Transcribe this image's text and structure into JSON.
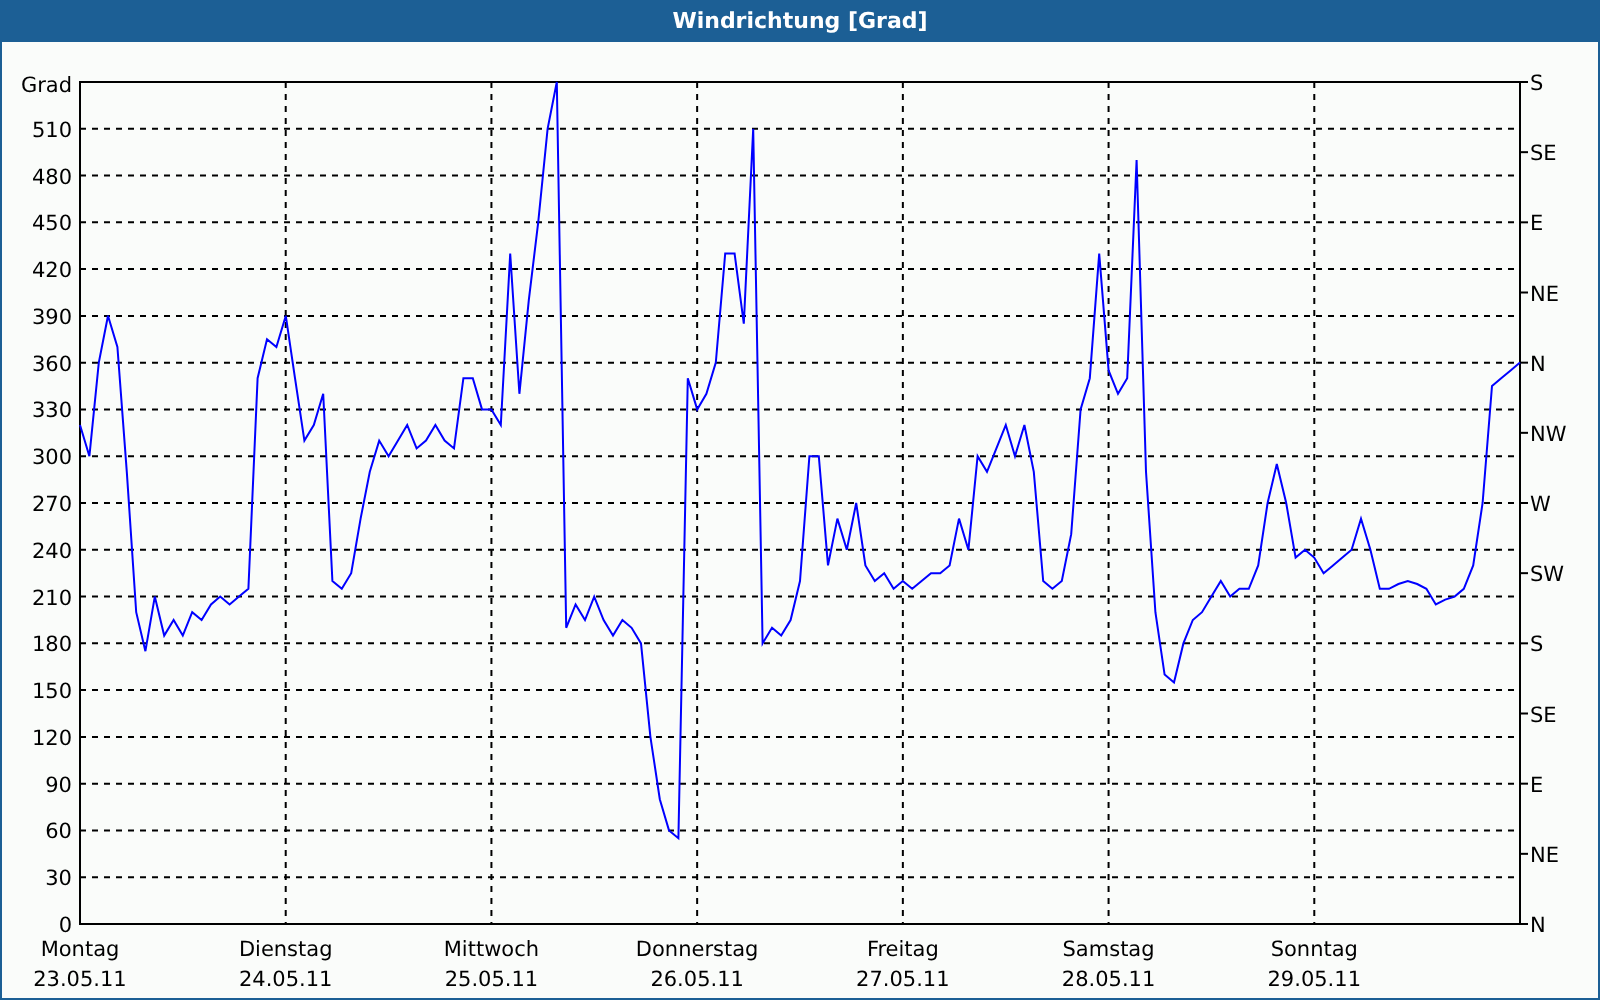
{
  "window": {
    "title": "Windrichtung [Grad]"
  },
  "chart": {
    "right_ticks": [
      "S",
      "SE",
      "E",
      "NE",
      "N",
      "NW",
      "W",
      "SW",
      "S",
      "SE",
      "E",
      "NE",
      "N"
    ],
    "chart_data": {
      "type": "line",
      "ylabel": "Grad",
      "grid": true,
      "ylim": [
        0,
        540
      ],
      "yticks": [
        0,
        30,
        60,
        90,
        120,
        150,
        180,
        210,
        240,
        270,
        300,
        330,
        360,
        390,
        420,
        450,
        480,
        510
      ],
      "categories": [
        "Montag\n23.05.11",
        null,
        null,
        null,
        null,
        null,
        null,
        null,
        null,
        null,
        null,
        null,
        null,
        null,
        null,
        null,
        null,
        null,
        null,
        null,
        null,
        null,
        "Dienstag\n24.05.11",
        null,
        null,
        null,
        null,
        null,
        null,
        null,
        null,
        null,
        null,
        null,
        null,
        null,
        null,
        null,
        null,
        null,
        null,
        null,
        null,
        null,
        "Mittwoch\n25.05.11",
        null,
        null,
        null,
        null,
        null,
        null,
        null,
        null,
        null,
        null,
        null,
        null,
        null,
        null,
        null,
        null,
        null,
        null,
        null,
        null,
        null,
        "Donnerstag\n26.05.11",
        null,
        null,
        null,
        null,
        null,
        null,
        null,
        null,
        null,
        null,
        null,
        null,
        null,
        null,
        null,
        null,
        null,
        null,
        null,
        null,
        null,
        "Freitag\n27.05.11",
        null,
        null,
        null,
        null,
        null,
        null,
        null,
        null,
        null,
        null,
        null,
        null,
        null,
        null,
        null,
        null,
        null,
        null,
        null,
        null,
        null,
        "Samstag\n28.05.11",
        null,
        null,
        null,
        null,
        null,
        null,
        null,
        null,
        null,
        null,
        null,
        null,
        null,
        null,
        null,
        null,
        null,
        null,
        null,
        null,
        null,
        "Sonntag\n29.05.11",
        null,
        null,
        null,
        null,
        null,
        null,
        null,
        null,
        null,
        null,
        null,
        null,
        null,
        null,
        null,
        null,
        null,
        null,
        null,
        null,
        null,
        null
      ],
      "series": [
        {
          "color": "#0000ff",
          "values": [
            320,
            300,
            360,
            390,
            370,
            290,
            200,
            175,
            210,
            185,
            195,
            185,
            200,
            195,
            205,
            210,
            205,
            210,
            215,
            350,
            375,
            370,
            390,
            350,
            310,
            320,
            340,
            220,
            215,
            225,
            260,
            290,
            310,
            300,
            310,
            320,
            305,
            310,
            320,
            310,
            305,
            350,
            350,
            330,
            330,
            320,
            430,
            340,
            400,
            450,
            510,
            540,
            190,
            205,
            195,
            210,
            195,
            185,
            195,
            190,
            180,
            120,
            80,
            60,
            55,
            350,
            330,
            340,
            360,
            430,
            430,
            385,
            510,
            180,
            190,
            185,
            195,
            220,
            300,
            300,
            230,
            260,
            240,
            270,
            230,
            220,
            225,
            215,
            220,
            215,
            220,
            225,
            225,
            230,
            260,
            240,
            300,
            290,
            305,
            320,
            300,
            320,
            290,
            220,
            215,
            220,
            250,
            330,
            350,
            430,
            355,
            340,
            350,
            490,
            290,
            200,
            160,
            155,
            180,
            195,
            200,
            210,
            220,
            210,
            215,
            215,
            230,
            270,
            295,
            270,
            235,
            240,
            235,
            225,
            230,
            235,
            240,
            260,
            240,
            215,
            215,
            218,
            220,
            218,
            215,
            205,
            208,
            210,
            215,
            230,
            270,
            345,
            350,
            355,
            360
          ]
        }
      ]
    }
  }
}
